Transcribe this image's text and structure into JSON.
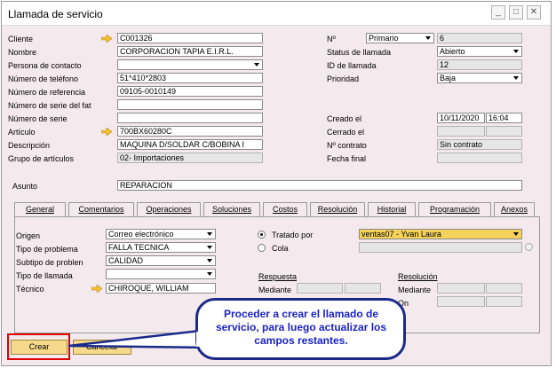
{
  "window": {
    "title": "Llamada de servicio",
    "buttons": {
      "minimize": "_",
      "maximize": "□",
      "close": "✕"
    }
  },
  "left_fields": [
    {
      "label": "Cliente",
      "value": "C001326",
      "arrow": true
    },
    {
      "label": "Nombre",
      "value": "CORPORACION TAPIA E.I.R.L."
    },
    {
      "label": "Persona de contacto",
      "value": ""
    },
    {
      "label": "Número de teléfono",
      "value": "51*410*2803"
    },
    {
      "label": "Número de referencia",
      "value": "09105-0010149"
    },
    {
      "label": "Número de serie del fat",
      "value": ""
    },
    {
      "label": "Número de serie",
      "value": ""
    },
    {
      "label": "Artículo",
      "value": "700BX60280C",
      "arrow": true
    },
    {
      "label": "Descripción",
      "value": "MAQUINA D/SOLDAR C/BOBINA I"
    },
    {
      "label": "Grupo de artículos",
      "value": "02- Importaciones"
    }
  ],
  "right_fields": {
    "numero": {
      "label": "Nº",
      "series": "Primario",
      "value": "6"
    },
    "status": {
      "label": "Status de llamada",
      "value": "Abierto"
    },
    "id": {
      "label": "ID de llamada",
      "value": "12"
    },
    "prioridad": {
      "label": "Prioridad",
      "value": "Baja"
    },
    "creado": {
      "label": "Creado el",
      "date": "10/11/2020",
      "time": "16:04"
    },
    "cerrado": {
      "label": "Cerrado el"
    },
    "contrato": {
      "label": "Nº contrato",
      "value": "Sin contrato"
    },
    "fecha_final": {
      "label": "Fecha final"
    }
  },
  "asunto": {
    "label": "Asunto",
    "value": "REPARACION"
  },
  "tabs": [
    "General",
    "Comentarios",
    "Operaciones",
    "Soluciones",
    "Costos",
    "Resolución",
    "Historial",
    "Programación",
    "Anexos"
  ],
  "general": {
    "origen": {
      "label": "Origen",
      "value": "Correo electrónico"
    },
    "tipo_problema": {
      "label": "Tipo de problema",
      "value": "FALLA TECNICA"
    },
    "subtipo": {
      "label": "Subtipo de problen",
      "value": "CALIDAD"
    },
    "tipo_llamada": {
      "label": "Tipo de llamada",
      "value": ""
    },
    "tecnico": {
      "label": "Técnico",
      "value": "CHIROQUE, WILLIAM"
    },
    "tratado_por": {
      "label": "Tratado por",
      "value": "ventas07 -  Yvan Laura"
    },
    "cola": {
      "label": "Cola"
    },
    "respuesta": {
      "header": "Respuesta",
      "mediante": "Mediante"
    },
    "resolucion": {
      "header": "Resolución",
      "mediante": "Mediante",
      "on": "On"
    }
  },
  "footer": {
    "crear": "Crear",
    "cancelar": "Cancelar"
  },
  "callout": {
    "text": "Proceder a crear el llamado de servicio, para luego actualizar los campos restantes."
  },
  "colors": {
    "background": "#f4e9ec",
    "button": "#f6d98a",
    "highlight_field": "#f5d35b",
    "annotation_border": "#e00000",
    "callout_text": "#1a22c8"
  }
}
